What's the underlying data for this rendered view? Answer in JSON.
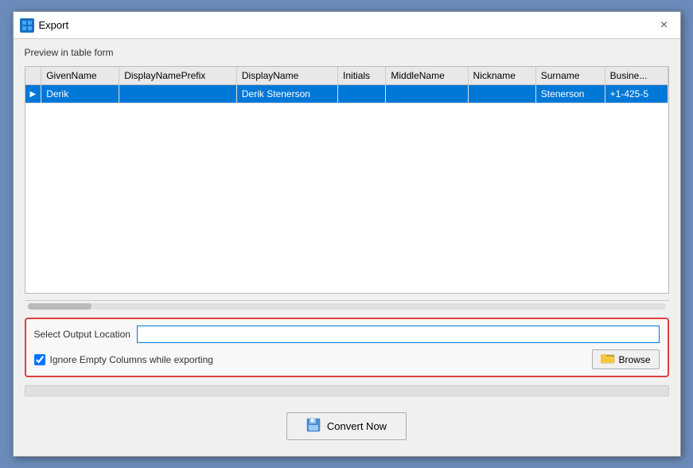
{
  "window": {
    "title": "Export",
    "icon": "▤",
    "close_label": "×"
  },
  "preview": {
    "label": "Preview in table form"
  },
  "table": {
    "columns": [
      {
        "id": "arrow",
        "label": ""
      },
      {
        "id": "given_name",
        "label": "GivenName"
      },
      {
        "id": "display_name_prefix",
        "label": "DisplayNamePrefix"
      },
      {
        "id": "display_name",
        "label": "DisplayName"
      },
      {
        "id": "initials",
        "label": "Initials"
      },
      {
        "id": "middle_name",
        "label": "MiddleName"
      },
      {
        "id": "nickname",
        "label": "Nickname"
      },
      {
        "id": "surname",
        "label": "Surname"
      },
      {
        "id": "business",
        "label": "Busine..."
      }
    ],
    "rows": [
      {
        "selected": true,
        "arrow": "▶",
        "given_name": "Derik",
        "display_name_prefix": "",
        "display_name": "Derik Stenerson",
        "initials": "",
        "middle_name": "",
        "nickname": "",
        "surname": "Stenerson",
        "business": "+1-425-5"
      }
    ]
  },
  "output": {
    "select_location_label": "Select Output Location",
    "input_placeholder": "",
    "input_value": "",
    "ignore_label": "Ignore Empty Columns while exporting",
    "ignore_checked": true,
    "browse_label": "Browse"
  },
  "convert": {
    "button_label": "Convert Now"
  }
}
